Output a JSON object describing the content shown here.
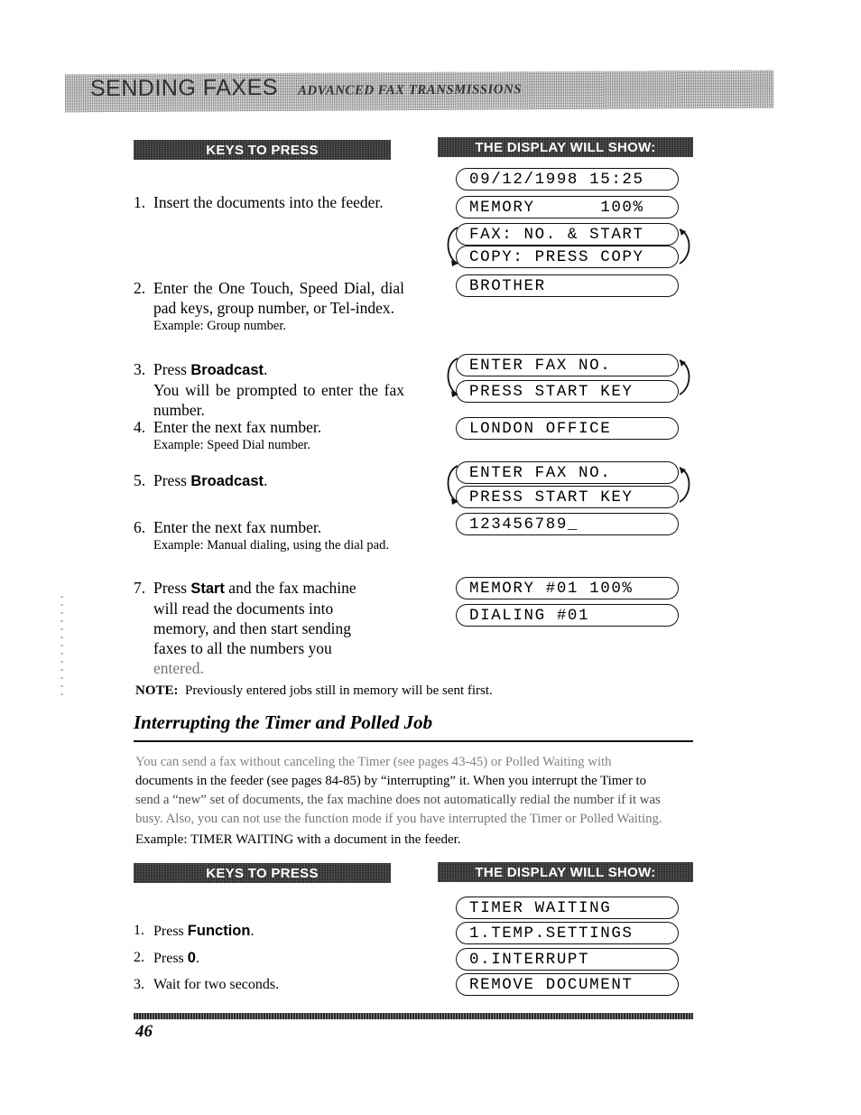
{
  "header": {
    "title": "SENDING FAXES",
    "subtitle": "ADVANCED FAX TRANSMISSIONS"
  },
  "columns": {
    "keys_label": "KEYS TO PRESS",
    "display_label": "THE DISPLAY WILL SHOW:"
  },
  "broadcast_section": {
    "steps": [
      {
        "num": "1.",
        "text": "Insert the documents into the feeder."
      },
      {
        "num": "2.",
        "text": "Enter the One Touch, Speed Dial, dial pad keys, group number, or Tel-index.",
        "example": "Example: Group number."
      },
      {
        "num": "3.",
        "lead": "Press ",
        "key": "Broadcast",
        "tail": ".",
        "detail": "You will be prompted to enter the fax number."
      },
      {
        "num": "4.",
        "text": "Enter the next fax number.",
        "example": "Example:  Speed Dial number."
      },
      {
        "num": "5.",
        "lead": "Press ",
        "key": "Broadcast",
        "tail": "."
      },
      {
        "num": "6.",
        "text": "Enter the next fax number.",
        "example": "Example: Manual dialing, using the dial pad."
      },
      {
        "num": "7.",
        "lead": "Press ",
        "key": "Start",
        "tail": " and the fax machine",
        "cont": [
          "will read the documents into",
          "memory, and then start sending",
          "faxes to all the numbers you"
        ],
        "last": "entered."
      }
    ],
    "displays": [
      {
        "text": "09/12/1998 15:25"
      },
      {
        "text": "MEMORY      100%"
      },
      {
        "text": "FAX: NO. & START"
      },
      {
        "text": "COPY: PRESS COPY"
      },
      {
        "text": "BROTHER"
      },
      {
        "text": "ENTER FAX NO."
      },
      {
        "text": "PRESS START KEY"
      },
      {
        "text": "LONDON OFFICE"
      },
      {
        "text": "ENTER FAX NO."
      },
      {
        "text": "PRESS START KEY"
      },
      {
        "text": "123456789_"
      },
      {
        "text": "MEMORY #01 100%"
      },
      {
        "text": "DIALING #01"
      }
    ]
  },
  "note": {
    "label": "NOTE:",
    "text": "Previously entered jobs still in memory will be sent first."
  },
  "section": {
    "heading": "Interrupting the Timer and Polled Job",
    "paragraph_lines": [
      "You can send a fax without canceling the Timer (see pages 43-45) or Polled Waiting with",
      "documents in the feeder (see pages 84-85) by “interrupting” it. When you interrupt the Timer to",
      "send a “new” set of documents, the fax machine does not automatically redial the number if it was",
      "busy. Also, you can not use the function mode if you have interrupted the Timer or Polled Waiting."
    ],
    "example": "Example: TIMER WAITING with a document in the feeder."
  },
  "interrupt_section": {
    "steps": [
      {
        "num": "1.",
        "lead": "Press ",
        "key": "Function",
        "tail": "."
      },
      {
        "num": "2.",
        "lead": "Press ",
        "key": "0",
        "tail": "."
      },
      {
        "num": "3.",
        "text": "Wait for two seconds."
      }
    ],
    "displays": [
      {
        "text": "TIMER WAITING"
      },
      {
        "text": "1.TEMP.SETTINGS"
      },
      {
        "text": "0.INTERRUPT"
      },
      {
        "text": "REMOVE DOCUMENT"
      }
    ]
  },
  "footer": {
    "page_number": "46"
  }
}
